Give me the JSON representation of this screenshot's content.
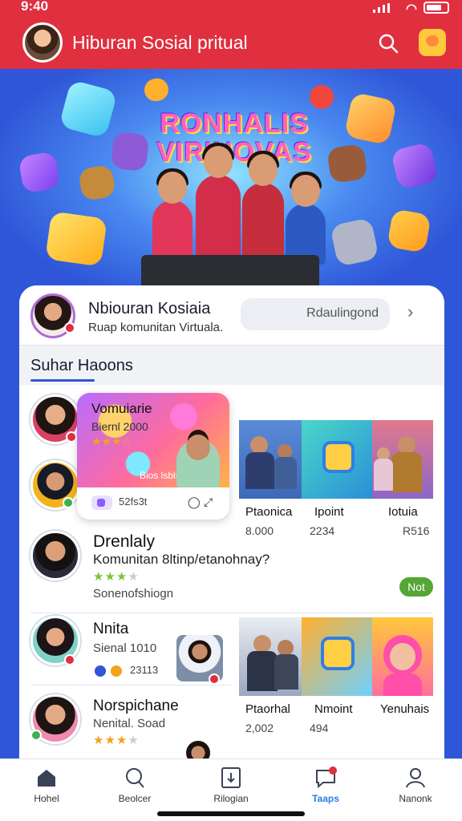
{
  "status_bar": {
    "time": "9:40"
  },
  "header": {
    "title": "Hiburan Sosial pritual",
    "search_icon": "search-icon",
    "gift_icon": "gift-icon",
    "colors": {
      "bar": "#e02f3f"
    }
  },
  "hero": {
    "title_line1": "RONHALIS",
    "title_line2": "VIRINOVAS"
  },
  "profile": {
    "name": "Nbiouran Kosiaia",
    "subtitle": "Ruap komunitan Virtuala.",
    "input_value": "Rdaulingond"
  },
  "section": {
    "title": "Suhar Haoons"
  },
  "popup": {
    "name": "Vomuiarie",
    "sub": "Biernl 2000",
    "caption": "Bios lsblsl",
    "count": "52fs3t"
  },
  "items": [
    {
      "name": "Drenlaly",
      "sub": "Komunitan 8ltinp/etanohnay?",
      "extra": "Sonenofshiogn",
      "join": "Not"
    },
    {
      "name": "Nnita",
      "sub": "Sienal 1010",
      "count": "23113"
    },
    {
      "name": "Norspichane",
      "sub": "Nenital. Soad"
    }
  ],
  "grid_top": [
    {
      "caption": "Ptaonica",
      "value": "8.000"
    },
    {
      "caption": "Ipoint",
      "value": "2234"
    },
    {
      "caption": "Iotuia",
      "value": "R516"
    }
  ],
  "grid_bottom": [
    {
      "caption": "Ptaorhal",
      "value": "2,002"
    },
    {
      "caption": "Nmoint",
      "value": "494"
    },
    {
      "caption": "Yenuhais",
      "value": ""
    }
  ],
  "nav": [
    {
      "label": "Hohel",
      "icon": "home-icon"
    },
    {
      "label": "Beolcer",
      "icon": "search-icon"
    },
    {
      "label": "Rilogian",
      "icon": "download-icon"
    },
    {
      "label": "Taaps",
      "icon": "chat-icon",
      "active": true
    },
    {
      "label": "Nanonk",
      "icon": "profile-icon"
    }
  ]
}
